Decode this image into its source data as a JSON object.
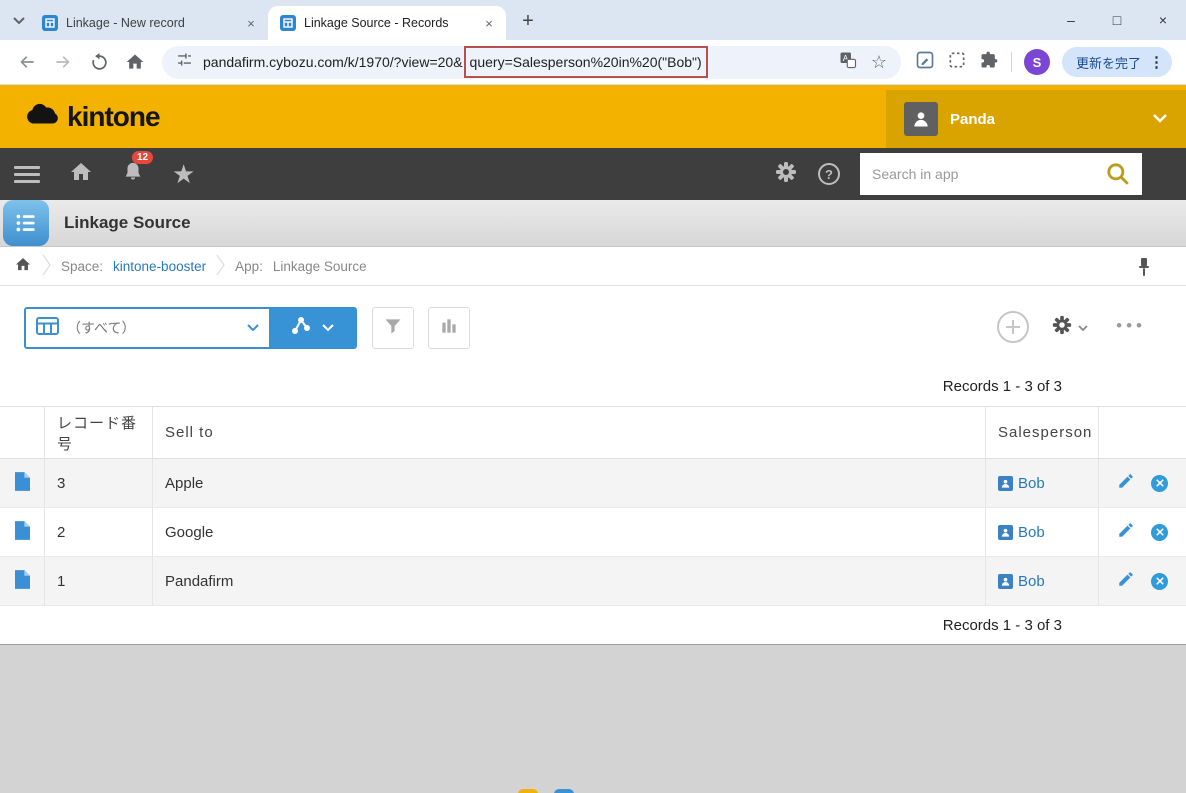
{
  "colors": {
    "kintone_yellow": "#f3b200",
    "kintone_yellow_dark": "#d9a400",
    "accent_blue": "#3793d6",
    "link_blue": "#2779bd",
    "highlight_red": "#b5524e",
    "nav_dark": "#3e3e3e"
  },
  "browser": {
    "tabs": [
      {
        "title": "Linkage - New record"
      },
      {
        "title": "Linkage Source - Records"
      }
    ],
    "url_prefix": "pandafirm.cybozu.com/k/1970/?view=20&",
    "url_query": "query=Salesperson%20in%20(\"Bob\")",
    "avatar_letter": "S",
    "update_button_label": "更新を完了"
  },
  "header": {
    "logo_text": "kintone",
    "user_name": "Panda",
    "notification_badge": "12",
    "search_placeholder": "Search in app"
  },
  "app": {
    "title": "Linkage Source",
    "breadcrumb_space_label": "Space:",
    "breadcrumb_space_name": "kintone-booster",
    "breadcrumb_app_label": "App:",
    "breadcrumb_app_name": "Linkage Source",
    "view_name": "（すべて）",
    "records_count": "Records 1 - 3 of 3"
  },
  "table": {
    "headers": {
      "record_number": "レコード番号",
      "sell_to": "Sell to",
      "salesperson": "Salesperson"
    },
    "rows": [
      {
        "record_number": "3",
        "sell_to": "Apple",
        "salesperson": "Bob"
      },
      {
        "record_number": "2",
        "sell_to": "Google",
        "salesperson": "Bob"
      },
      {
        "record_number": "1",
        "sell_to": "Pandafirm",
        "salesperson": "Bob"
      }
    ]
  }
}
